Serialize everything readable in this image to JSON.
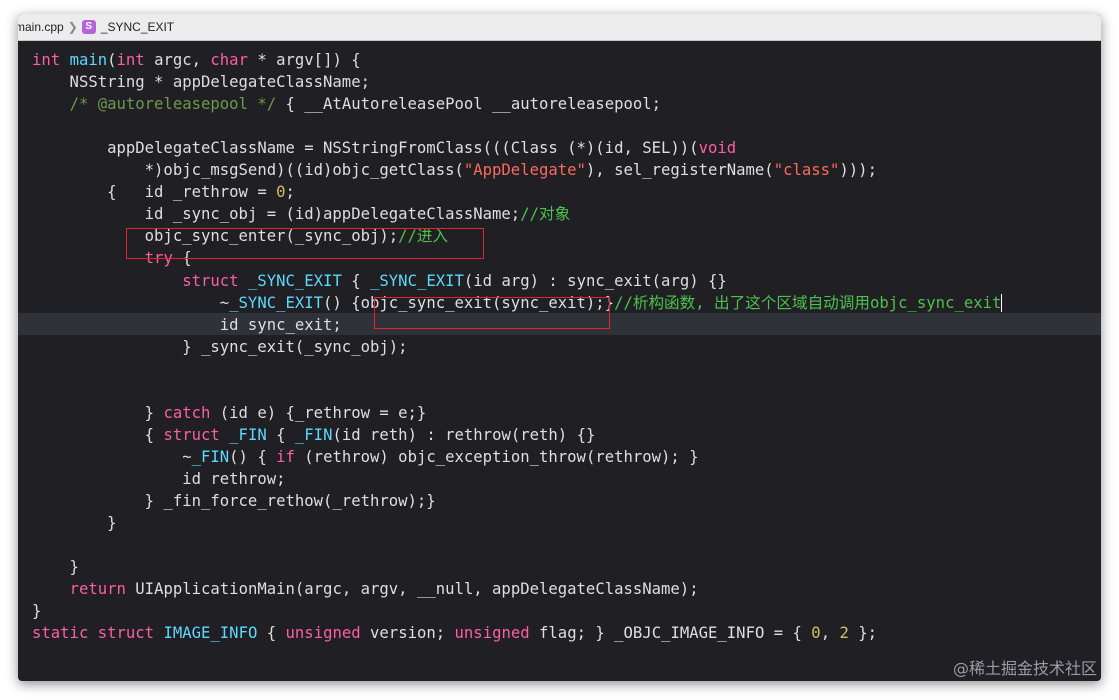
{
  "jumpbar": {
    "file": "main.cpp",
    "symbol_icon": "S",
    "symbol": "_SYNC_EXIT"
  },
  "code": [
    [
      [
        "kw",
        "int"
      ],
      [
        "p",
        " "
      ],
      [
        "typ",
        "main"
      ],
      [
        "p",
        "("
      ],
      [
        "kw",
        "int"
      ],
      [
        "p",
        " argc, "
      ],
      [
        "kw",
        "char"
      ],
      [
        "p",
        " * argv[]) {"
      ]
    ],
    [
      [
        "p",
        "    NSString * appDelegateClassName;"
      ]
    ],
    [
      [
        "p",
        "    "
      ],
      [
        "cmt",
        "/* @autoreleasepool */"
      ],
      [
        "p",
        " { __AtAutoreleasePool __autoreleasepool;"
      ]
    ],
    [],
    [
      [
        "p",
        "        appDelegateClassName = NSStringFromClass(((Class (*)(id, SEL))("
      ],
      [
        "kw",
        "void"
      ]
    ],
    [
      [
        "p",
        "            *)objc_msgSend)((id)objc_getClass("
      ],
      [
        "str",
        "\"AppDelegate\""
      ],
      [
        "p",
        "), sel_registerName("
      ],
      [
        "str",
        "\"class\""
      ],
      [
        "p",
        ")));"
      ]
    ],
    [
      [
        "p",
        "        {   id _rethrow = "
      ],
      [
        "num",
        "0"
      ],
      [
        "p",
        ";"
      ]
    ],
    [
      [
        "p",
        "            id _sync_obj = (id)appDelegateClassName;"
      ],
      [
        "cmt-green",
        "//对象"
      ]
    ],
    [
      [
        "p",
        "            objc_sync_enter(_sync_obj);"
      ],
      [
        "cmt-green",
        "//进入"
      ]
    ],
    [
      [
        "p",
        "            "
      ],
      [
        "kw",
        "try"
      ],
      [
        "p",
        " {"
      ]
    ],
    [
      [
        "p",
        "                "
      ],
      [
        "kw",
        "struct"
      ],
      [
        "p",
        " "
      ],
      [
        "typ",
        "_SYNC_EXIT"
      ],
      [
        "p",
        " { "
      ],
      [
        "typ",
        "_SYNC_EXIT"
      ],
      [
        "p",
        "(id arg) : sync_exit(arg) {}"
      ]
    ],
    [
      [
        "p",
        "                    ~"
      ],
      [
        "typ",
        "_SYNC_EXIT"
      ],
      [
        "p",
        "() {objc_sync_exit(sync_exit);}"
      ],
      [
        "cmt-green",
        "//析构函数, 出了这个区域自动调用objc_sync_exit"
      ]
    ],
    [
      [
        "p",
        "                    id sync_exit;"
      ]
    ],
    [
      [
        "p",
        "                } _sync_exit(_sync_obj);"
      ]
    ],
    [],
    [],
    [
      [
        "p",
        "            } "
      ],
      [
        "kw",
        "catch"
      ],
      [
        "p",
        " (id e) {_rethrow = e;}"
      ]
    ],
    [
      [
        "p",
        "            { "
      ],
      [
        "kw",
        "struct"
      ],
      [
        "p",
        " "
      ],
      [
        "typ",
        "_FIN"
      ],
      [
        "p",
        " { "
      ],
      [
        "typ",
        "_FIN"
      ],
      [
        "p",
        "(id reth) : rethrow(reth) {}"
      ]
    ],
    [
      [
        "p",
        "                ~"
      ],
      [
        "typ",
        "_FIN"
      ],
      [
        "p",
        "() { "
      ],
      [
        "kw",
        "if"
      ],
      [
        "p",
        " (rethrow) objc_exception_throw(rethrow); }"
      ]
    ],
    [
      [
        "p",
        "                id rethrow;"
      ]
    ],
    [
      [
        "p",
        "            } _fin_force_rethow(_rethrow);}"
      ]
    ],
    [
      [
        "p",
        "        }"
      ]
    ],
    [],
    [
      [
        "p",
        "    }"
      ]
    ],
    [
      [
        "p",
        "    "
      ],
      [
        "kw",
        "return"
      ],
      [
        "p",
        " UIApplicationMain(argc, argv, __null, appDelegateClassName);"
      ]
    ],
    [
      [
        "p",
        "}"
      ]
    ],
    [
      [
        "kw",
        "static"
      ],
      [
        "p",
        " "
      ],
      [
        "kw",
        "struct"
      ],
      [
        "p",
        " "
      ],
      [
        "typ",
        "IMAGE_INFO"
      ],
      [
        "p",
        " { "
      ],
      [
        "kw",
        "unsigned"
      ],
      [
        "p",
        " version; "
      ],
      [
        "kw",
        "unsigned"
      ],
      [
        "p",
        " flag; } _OBJC_IMAGE_INFO = { "
      ],
      [
        "num",
        "0"
      ],
      [
        "p",
        ", "
      ],
      [
        "num",
        "2"
      ],
      [
        "p",
        " };"
      ]
    ]
  ],
  "colors": {
    "keyword": "#fc5fa3",
    "type": "#5dd8ff",
    "string": "#fc6a5d",
    "number": "#d0bf69",
    "comment": "#6c9a4a",
    "chinese_comment": "#4ec14e",
    "annotation_box": "#e0262a",
    "editor_bg": "#1f1f24"
  },
  "watermark": "@稀土掘金技术社区"
}
